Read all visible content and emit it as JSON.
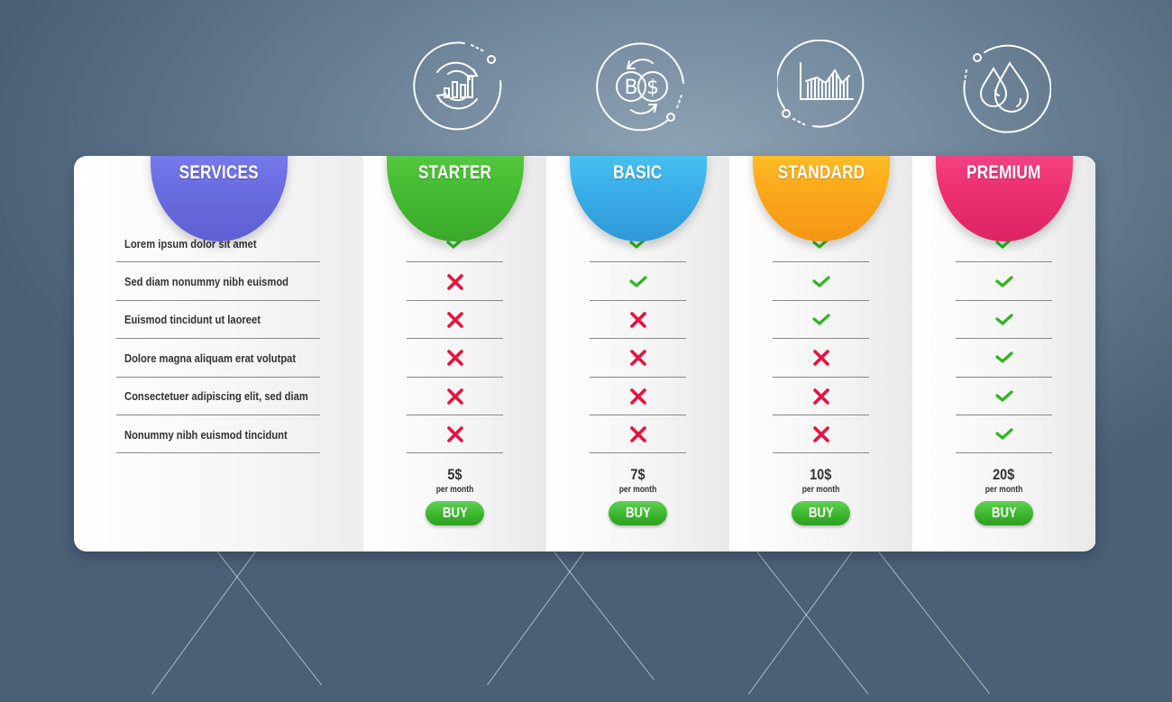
{
  "colors": {
    "services": "#6b6ee0",
    "starter": "#46bd34",
    "basic": "#3cb0ea",
    "standard": "#fbab1c",
    "premium": "#ee3273",
    "check": "#2fb61f",
    "cross": "#e8123f",
    "buy": "#3fb92f"
  },
  "services": {
    "title": "SERVICES",
    "features": [
      "Lorem ipsum dolor sit amet",
      "Sed diam nonummy nibh euismod",
      "Euismod tincidunt ut laoreet",
      "Dolore magna aliquam erat volutpat",
      "Consectetuer adipiscing elit, sed diam",
      "Nonummy nibh euismod tincidunt"
    ]
  },
  "plans": [
    {
      "name": "STARTER",
      "icon": "refresh-chart-icon",
      "features": [
        true,
        false,
        false,
        false,
        false,
        false
      ],
      "price": "5$",
      "period": "per month",
      "buy_label": "BUY"
    },
    {
      "name": "BASIC",
      "icon": "bitcoin-dollar-exchange-icon",
      "features": [
        true,
        true,
        false,
        false,
        false,
        false
      ],
      "price": "7$",
      "period": "per month",
      "buy_label": "BUY"
    },
    {
      "name": "STANDARD",
      "icon": "line-chart-icon",
      "features": [
        true,
        true,
        true,
        false,
        false,
        false
      ],
      "price": "10$",
      "period": "per month",
      "buy_label": "BUY"
    },
    {
      "name": "PREMIUM",
      "icon": "water-drops-icon",
      "features": [
        true,
        true,
        true,
        true,
        true,
        true
      ],
      "price": "20$",
      "period": "per month",
      "buy_label": "BUY"
    }
  ]
}
